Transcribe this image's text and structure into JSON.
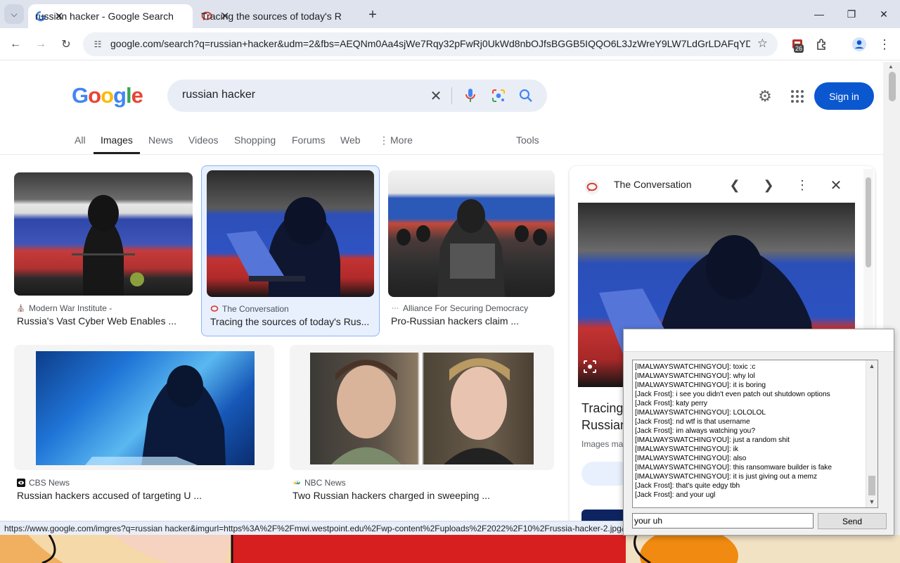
{
  "browser": {
    "tabs": [
      {
        "title": "russian hacker - Google Search",
        "active": true
      },
      {
        "title": "Tracing the sources of today's R",
        "active": false
      }
    ],
    "url": "google.com/search?q=russian+hacker&udm=2&fbs=AEQNm0Aa4sjWe7Rqy32pFwRj0UkWd8nbOJfsBGGB5IQQO6L3JzWreY9LW7LdGrLDAFqYDH...",
    "extension_badge": "26"
  },
  "google": {
    "logo": [
      "G",
      "o",
      "o",
      "g",
      "l",
      "e"
    ],
    "logo_colors": [
      "#4285F4",
      "#EA4335",
      "#FBBC05",
      "#4285F4",
      "#34A853",
      "#EA4335"
    ],
    "query": "russian hacker",
    "sign_in": "Sign in",
    "nav": [
      "All",
      "Images",
      "News",
      "Videos",
      "Shopping",
      "Forums",
      "Web",
      "More",
      "Tools"
    ],
    "active_nav": "Images"
  },
  "results": [
    {
      "source": "Modern War Institute -",
      "title": "Russia's Vast Cyber Web Enables ..."
    },
    {
      "source": "The Conversation",
      "title": "Tracing the sources of today's Rus..."
    },
    {
      "source": "Alliance For Securing Democracy",
      "title": "Pro-Russian hackers claim ..."
    },
    {
      "source": "CBS News",
      "title": "Russian hackers accused of targeting U ..."
    },
    {
      "source": "NBC News",
      "title": "Two Russian hackers charged in sweeping ..."
    }
  ],
  "preview": {
    "source": "The Conversation",
    "title_line1": "Tracing",
    "title_line2": "Russian",
    "note": "Images ma"
  },
  "status_url": "https://www.google.com/imgres?q=russian hacker&imgurl=https%3A%2F%2Fmwi.westpoint.edu%2Fwp-content%2Fuploads%2F2022%2F10%2Frussia-hacker-2.jpg&im",
  "chat": {
    "messages": [
      "[IMALWAYSWATCHINGYOU]: toxic :c",
      "[IMALWAYSWATCHINGYOU]: why lol",
      "[IMALWAYSWATCHINGYOU]: it is boring",
      "[Jack Frost]: i see you didn't even patch out shutdown options",
      "[Jack Frost]: katy perry",
      "[IMALWAYSWATCHINGYOU]: LOLOLOL",
      "[Jack Frost]: nd wtf is that username",
      "[Jack Frost]: im always watching you?",
      "[IMALWAYSWATCHINGYOU]: just a random shit",
      "[IMALWAYSWATCHINGYOU]: ik",
      "[IMALWAYSWATCHINGYOU]: also",
      "[IMALWAYSWATCHINGYOU]: this ransomware builder is fake",
      "[IMALWAYSWATCHINGYOU]: it is just giving out a memz",
      "[Jack Frost]: that's quite edgy tbh",
      "[Jack Frost]: and your ugl"
    ],
    "input_value": "your uh",
    "send_label": "Send"
  }
}
